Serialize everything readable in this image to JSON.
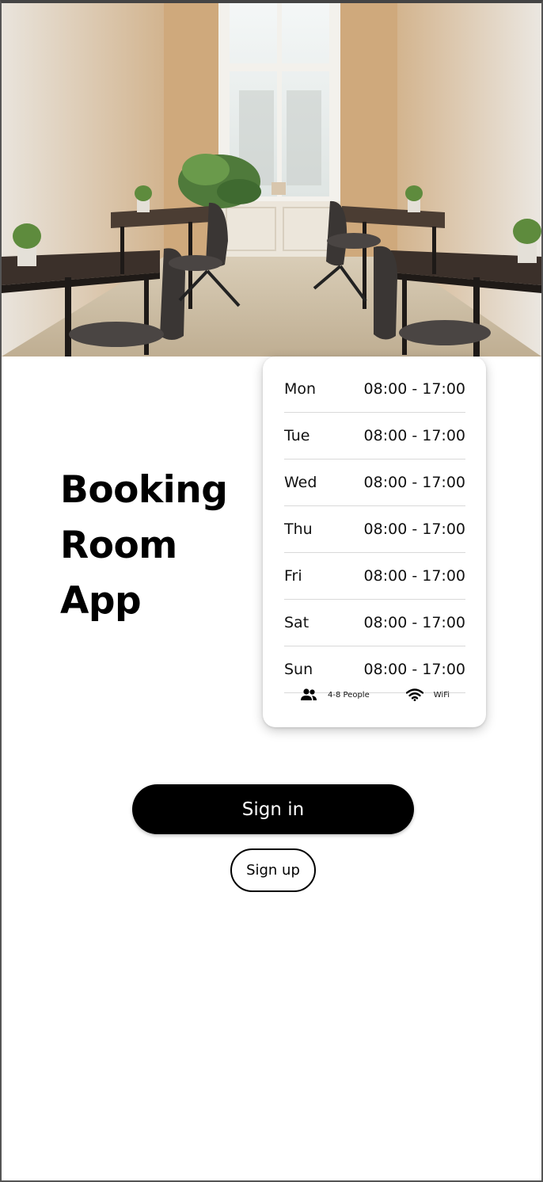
{
  "hero": {
    "image_description": "room-photo"
  },
  "title": {
    "line1": "Booking",
    "line2": "Room",
    "line3": "App"
  },
  "hours": [
    {
      "day": "Mon",
      "time": "08:00 - 17:00"
    },
    {
      "day": "Tue",
      "time": "08:00 - 17:00"
    },
    {
      "day": "Wed",
      "time": "08:00 - 17:00"
    },
    {
      "day": "Thu",
      "time": "08:00 - 17:00"
    },
    {
      "day": "Fri",
      "time": "08:00 - 17:00"
    },
    {
      "day": "Sat",
      "time": "08:00 - 17:00"
    },
    {
      "day": "Sun",
      "time": "08:00 - 17:00"
    }
  ],
  "amenities": {
    "people": {
      "label": "4-8 People",
      "icon": "people-icon"
    },
    "wifi": {
      "label": "WiFi",
      "icon": "wifi-icon"
    }
  },
  "buttons": {
    "signin_label": "Sign in",
    "signup_label": "Sign up"
  },
  "colors": {
    "primary": "#000000",
    "background": "#ffffff",
    "on_primary": "#ffffff"
  }
}
